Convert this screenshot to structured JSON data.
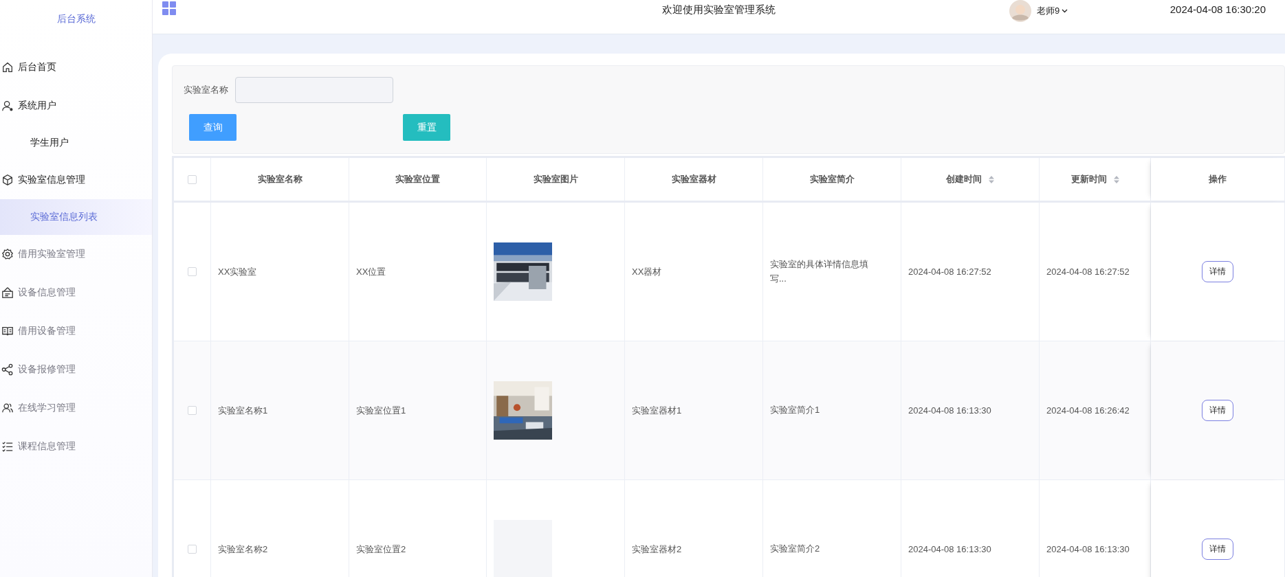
{
  "sidebar": {
    "title": "后台系统",
    "items": [
      {
        "label": "后台首页",
        "kind": "home",
        "highlighted": true
      },
      {
        "label": "系统用户",
        "kind": "user",
        "highlighted": true,
        "expanded": true,
        "children": [
          {
            "label": "学生用户",
            "selected": false
          }
        ]
      },
      {
        "label": "实验室信息管理",
        "kind": "cube",
        "highlighted": true,
        "expanded": true,
        "children": [
          {
            "label": "实验室信息列表",
            "selected": true
          }
        ]
      },
      {
        "label": "借用实验室管理",
        "kind": "gear",
        "highlighted": false
      },
      {
        "label": "设备信息管理",
        "kind": "board",
        "highlighted": false
      },
      {
        "label": "借用设备管理",
        "kind": "book",
        "highlighted": false
      },
      {
        "label": "设备报修管理",
        "kind": "share",
        "highlighted": false
      },
      {
        "label": "在线学习管理",
        "kind": "users",
        "highlighted": false
      },
      {
        "label": "课程信息管理",
        "kind": "list",
        "highlighted": false
      }
    ]
  },
  "header": {
    "title": "欢迎使用实验室管理系统",
    "user": "老师9",
    "datetime": "2024-04-08 16:30:20"
  },
  "filter": {
    "label": "实验室名称",
    "buttons": [
      {
        "label": "查询",
        "kind": "primary"
      },
      {
        "label": "重置",
        "kind": "reset"
      }
    ]
  },
  "table": {
    "select_all": {
      "checked": false
    },
    "columns": [
      {
        "label": "实验室名称",
        "sortable": false
      },
      {
        "label": "实验室位置",
        "sortable": false
      },
      {
        "label": "实验室图片",
        "sortable": false
      },
      {
        "label": "实验室器材",
        "sortable": false
      },
      {
        "label": "实验室简介",
        "sortable": false
      },
      {
        "label": "创建时间",
        "sortable": true
      },
      {
        "label": "更新时间",
        "sortable": true
      },
      {
        "label": "操作",
        "sortable": false
      }
    ],
    "rows": [
      {
        "checked": false,
        "name": "XX实验室",
        "location": "XX位置",
        "equipment": "XX器材",
        "intro": "实验室的具体详情信息填写...",
        "created": "2024-04-08 16:27:52",
        "updated": "2024-04-08 16:27:52",
        "action": "详情"
      },
      {
        "checked": false,
        "name": "实验室名称1",
        "location": "实验室位置1",
        "equipment": "实验室器材1",
        "intro": "实验室简介1",
        "created": "2024-04-08 16:13:30",
        "updated": "2024-04-08 16:26:42",
        "action": "详情"
      },
      {
        "checked": false,
        "name": "实验室名称2",
        "location": "实验室位置2",
        "image": {
          "kind": "placeholder"
        },
        "equipment": "实验室器材2",
        "intro": "实验室简介2",
        "created": "2024-04-08 16:13:30",
        "updated": "2024-04-08 16:13:30",
        "action": "详情"
      }
    ]
  }
}
